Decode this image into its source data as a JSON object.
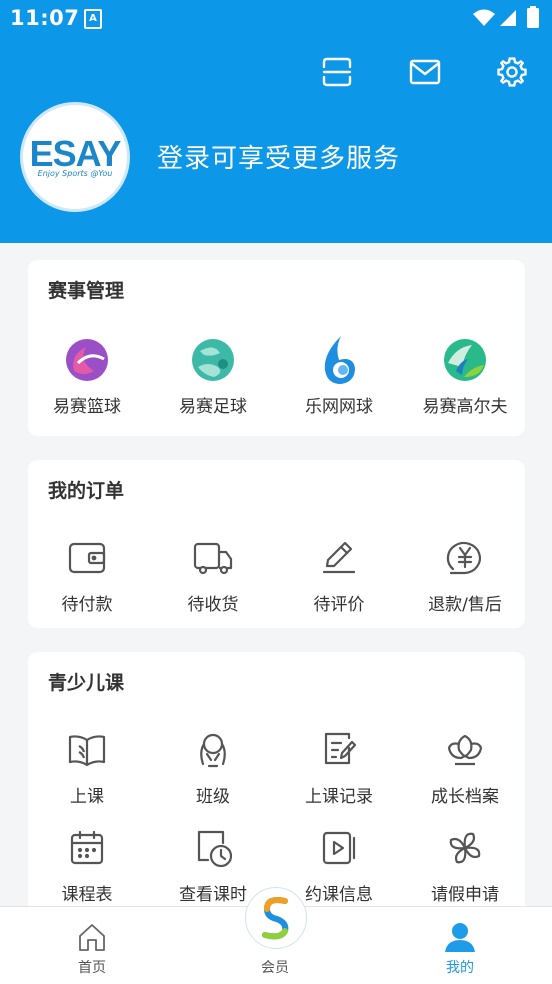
{
  "status_bar": {
    "time": "11:07",
    "app_badge": "A"
  },
  "header": {
    "logo_text": "ESAY",
    "logo_tagline": "Enjoy Sports @You",
    "login_prompt": "登录可享受更多服务"
  },
  "sections": {
    "events": {
      "title": "赛事管理",
      "items": [
        {
          "label": "易赛篮球",
          "icon": "basketball-logo-icon"
        },
        {
          "label": "易赛足球",
          "icon": "football-logo-icon"
        },
        {
          "label": "乐网网球",
          "icon": "tennis-logo-icon"
        },
        {
          "label": "易赛高尔夫",
          "icon": "golf-logo-icon"
        }
      ]
    },
    "orders": {
      "title": "我的订单",
      "items": [
        {
          "label": "待付款",
          "icon": "wallet-icon"
        },
        {
          "label": "待收货",
          "icon": "truck-icon"
        },
        {
          "label": "待评价",
          "icon": "pen-icon"
        },
        {
          "label": "退款/售后",
          "icon": "refund-icon"
        }
      ]
    },
    "kids": {
      "title": "青少儿课",
      "items": [
        {
          "label": "上课",
          "icon": "book-icon"
        },
        {
          "label": "班级",
          "icon": "class-icon"
        },
        {
          "label": "上课记录",
          "icon": "record-icon"
        },
        {
          "label": "成长档案",
          "icon": "flower-icon"
        },
        {
          "label": "课程表",
          "icon": "calendar-icon"
        },
        {
          "label": "查看课时",
          "icon": "clock-doc-icon"
        },
        {
          "label": "约课信息",
          "icon": "video-icon"
        },
        {
          "label": "请假申请",
          "icon": "pinwheel-icon"
        }
      ]
    }
  },
  "tabbar": {
    "home": "首页",
    "member": "会员",
    "mine": "我的"
  },
  "colors": {
    "primary": "#0d97e8",
    "active_tab": "#1e9be9",
    "icon_gray": "#555555"
  }
}
